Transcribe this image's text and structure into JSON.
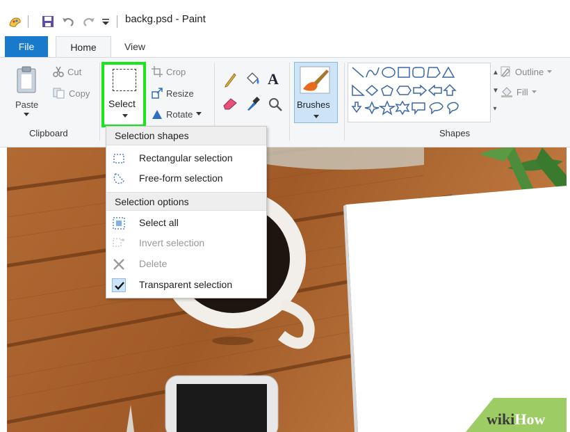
{
  "window": {
    "title": "backg.psd - Paint"
  },
  "tabs": [
    {
      "label": "File"
    },
    {
      "label": "Home"
    },
    {
      "label": "View"
    }
  ],
  "clipboard": {
    "paste": "Paste",
    "cut": "Cut",
    "copy": "Copy",
    "group": "Clipboard"
  },
  "image": {
    "select": "Select",
    "crop": "Crop",
    "resize": "Resize",
    "rotate": "Rotate"
  },
  "brushes": {
    "label": "Brushes"
  },
  "shapes": {
    "outline": "Outline",
    "fill": "Fill",
    "group": "Shapes"
  },
  "dropdown": {
    "header_shapes": "Selection shapes",
    "rectangular": "Rectangular selection",
    "freeform": "Free-form selection",
    "header_options": "Selection options",
    "select_all": "Select all",
    "invert": "Invert selection",
    "delete": "Delete",
    "transparent": "Transparent selection"
  },
  "watermark": {
    "wiki": "wiki",
    "how": "How"
  },
  "colors": {
    "accent": "#1979ca",
    "highlight": "#19e619",
    "ribbon": "#f5f6f7"
  }
}
